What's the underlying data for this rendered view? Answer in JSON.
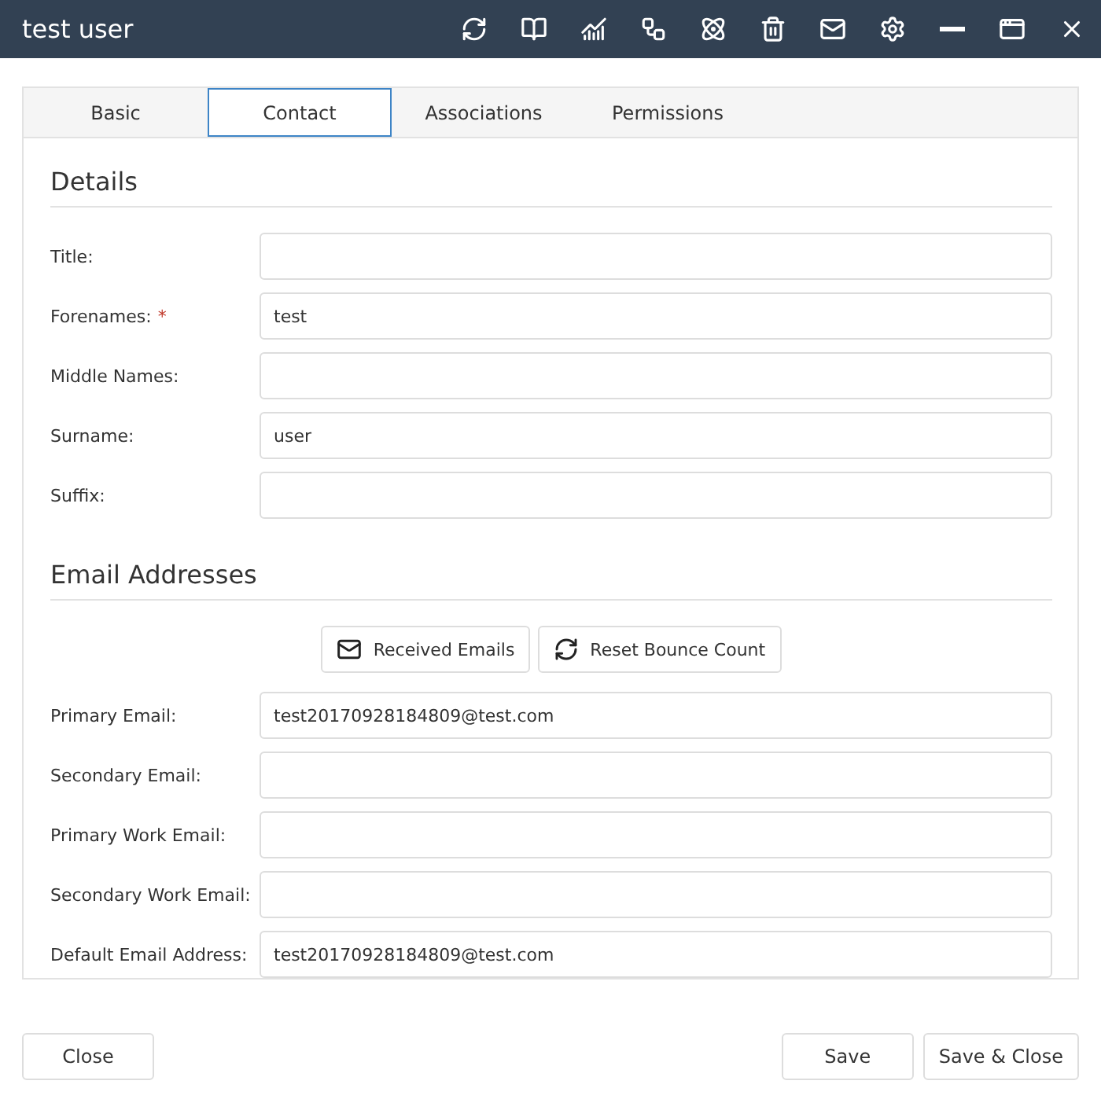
{
  "window": {
    "title": "test user",
    "toolbar": [
      {
        "kind": "refresh"
      },
      {
        "kind": "book"
      },
      {
        "kind": "chart"
      },
      {
        "kind": "network"
      },
      {
        "kind": "atom"
      },
      {
        "kind": "trash"
      },
      {
        "kind": "mail"
      },
      {
        "kind": "settings"
      },
      {
        "kind": "minimize"
      },
      {
        "kind": "maximize"
      },
      {
        "kind": "close"
      }
    ]
  },
  "tabs": [
    {
      "label": "Basic",
      "selected": false
    },
    {
      "label": "Contact",
      "selected": true
    },
    {
      "label": "Associations",
      "selected": false
    },
    {
      "label": "Permissions",
      "selected": false
    }
  ],
  "sections": [
    {
      "title": "Details",
      "fields": [
        {
          "label": "Title:"
        },
        {
          "label": "Forenames:",
          "required_mark": "*",
          "value": "test"
        },
        {
          "label": "Middle Names:"
        },
        {
          "label": "Surname:",
          "value": "user"
        },
        {
          "label": "Suffix:"
        }
      ]
    },
    {
      "title": "Email Addresses",
      "actions": [
        {
          "kind": "mail",
          "label": "Received Emails"
        },
        {
          "kind": "refresh",
          "label": "Reset Bounce Count"
        }
      ],
      "fields": [
        {
          "label": "Primary Email:",
          "value": "test20170928184809@test.com"
        },
        {
          "label": "Secondary Email:"
        },
        {
          "label": "Primary Work Email:"
        },
        {
          "label": "Secondary Work Email:"
        },
        {
          "label": "Default Email Address:",
          "value": "test20170928184809@test.com"
        }
      ]
    }
  ],
  "footer": {
    "left": [
      "Close"
    ],
    "right": [
      "Save",
      "Save & Close"
    ]
  }
}
